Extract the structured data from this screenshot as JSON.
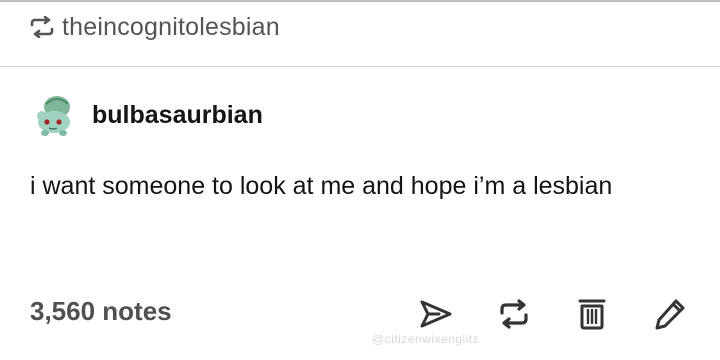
{
  "reblog": {
    "username": "theincognitolesbian",
    "icon": "reblog-icon"
  },
  "post": {
    "author": "bulbasaurbian",
    "avatar_icon": "bulbasaur-avatar",
    "text": "i want someone to look at me and hope i’m a lesbian",
    "notes": "3,560 notes"
  },
  "actions": {
    "icons": [
      "share-icon",
      "reblog-icon",
      "delete-icon",
      "edit-icon"
    ]
  },
  "watermark": "@citizenwixenglitz",
  "colors": {
    "text": "#141414",
    "muted": "#555555",
    "divider": "#cfcfcf",
    "icon": "#333333"
  }
}
